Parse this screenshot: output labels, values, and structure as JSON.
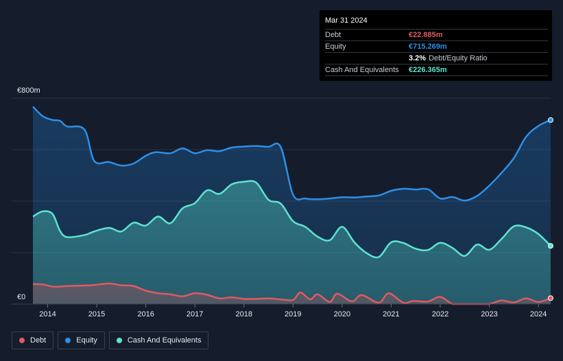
{
  "colors": {
    "debt": "#e05a62",
    "equity": "#2e8fe6",
    "cash": "#5fe3cf",
    "background": "#151c2b",
    "grid": "#2b3344"
  },
  "tooltip": {
    "date": "Mar 31 2024",
    "rows": [
      {
        "label": "Debt",
        "value": "€22.885m",
        "color": "#e05a62"
      },
      {
        "label": "Equity",
        "value": "€715.269m",
        "color": "#2e8fe6"
      },
      {
        "label": "",
        "value": "3.2%",
        "extra": "Debt/Equity Ratio",
        "color": "#ffffff"
      },
      {
        "label": "Cash And Equivalents",
        "value": "€226.365m",
        "color": "#5fe3cf"
      }
    ]
  },
  "legend": [
    {
      "label": "Debt",
      "color": "#e05a62"
    },
    {
      "label": "Equity",
      "color": "#2e8fe6"
    },
    {
      "label": "Cash And Equivalents",
      "color": "#5fe3cf"
    }
  ],
  "chart_data": {
    "type": "area",
    "y_unit": "€",
    "ylim": [
      0,
      800
    ],
    "y_tick_labels": {
      "top": "€800m",
      "bottom": "€0"
    },
    "x_range": [
      2013.7,
      2024.25
    ],
    "x_ticks": [
      "2014",
      "2015",
      "2016",
      "2017",
      "2018",
      "2019",
      "2020",
      "2021",
      "2022",
      "2023",
      "2024"
    ],
    "grid": true,
    "legend_position": "bottom-left",
    "series": [
      {
        "name": "Equity",
        "color": "#2e8fe6",
        "x": [
          2013.7,
          2013.9,
          2014.1,
          2014.25,
          2014.4,
          2014.75,
          2014.95,
          2015.25,
          2015.5,
          2015.75,
          2016.0,
          2016.2,
          2016.5,
          2016.75,
          2017.0,
          2017.25,
          2017.5,
          2017.75,
          2018.0,
          2018.25,
          2018.5,
          2018.75,
          2019.0,
          2019.25,
          2019.5,
          2019.75,
          2020.0,
          2020.25,
          2020.5,
          2020.75,
          2021.0,
          2021.25,
          2021.5,
          2021.75,
          2022.0,
          2022.25,
          2022.5,
          2022.75,
          2023.0,
          2023.25,
          2023.5,
          2023.75,
          2024.0,
          2024.25
        ],
        "values": [
          767,
          730,
          715,
          712,
          690,
          678,
          556,
          552,
          538,
          546,
          576,
          590,
          586,
          605,
          586,
          598,
          594,
          608,
          612,
          614,
          611,
          610,
          425,
          410,
          407,
          410,
          415,
          414,
          418,
          422,
          440,
          448,
          445,
          446,
          410,
          416,
          402,
          420,
          460,
          510,
          567,
          650,
          692,
          715
        ]
      },
      {
        "name": "Cash And Equivalents",
        "color": "#5fe3cf",
        "x": [
          2013.7,
          2013.9,
          2014.1,
          2014.25,
          2014.4,
          2014.75,
          2014.95,
          2015.25,
          2015.5,
          2015.75,
          2016.0,
          2016.25,
          2016.5,
          2016.75,
          2017.0,
          2017.25,
          2017.5,
          2017.75,
          2018.0,
          2018.25,
          2018.5,
          2018.75,
          2019.0,
          2019.25,
          2019.5,
          2019.75,
          2020.0,
          2020.25,
          2020.5,
          2020.75,
          2021.0,
          2021.25,
          2021.5,
          2021.75,
          2022.0,
          2022.25,
          2022.5,
          2022.75,
          2023.0,
          2023.25,
          2023.5,
          2023.75,
          2024.0,
          2024.25
        ],
        "values": [
          340,
          360,
          350,
          285,
          260,
          268,
          282,
          296,
          282,
          316,
          305,
          340,
          314,
          372,
          392,
          442,
          428,
          465,
          475,
          472,
          405,
          390,
          322,
          300,
          262,
          248,
          300,
          240,
          198,
          183,
          240,
          237,
          215,
          210,
          238,
          218,
          187,
          231,
          211,
          253,
          302,
          298,
          272,
          226
        ]
      },
      {
        "name": "Debt",
        "color": "#e05a62",
        "x": [
          2013.7,
          2013.9,
          2014.1,
          2014.25,
          2014.4,
          2014.75,
          2014.95,
          2015.25,
          2015.5,
          2015.75,
          2016.0,
          2016.25,
          2016.5,
          2016.75,
          2017.0,
          2017.25,
          2017.5,
          2017.75,
          2018.0,
          2018.25,
          2018.5,
          2018.75,
          2019.0,
          2019.15,
          2019.35,
          2019.5,
          2019.75,
          2019.9,
          2020.2,
          2020.4,
          2020.75,
          2020.95,
          2021.25,
          2021.45,
          2021.75,
          2022.0,
          2022.25,
          2022.5,
          2022.75,
          2023.0,
          2023.25,
          2023.5,
          2023.75,
          2024.0,
          2024.25
        ],
        "values": [
          78,
          76,
          68,
          68,
          70,
          72,
          74,
          80,
          73,
          70,
          52,
          42,
          38,
          30,
          42,
          36,
          22,
          26,
          20,
          20,
          22,
          18,
          16,
          45,
          18,
          38,
          8,
          40,
          10,
          35,
          5,
          42,
          5,
          12,
          10,
          28,
          0,
          0,
          0,
          0,
          14,
          6,
          22,
          8,
          23
        ]
      }
    ]
  }
}
